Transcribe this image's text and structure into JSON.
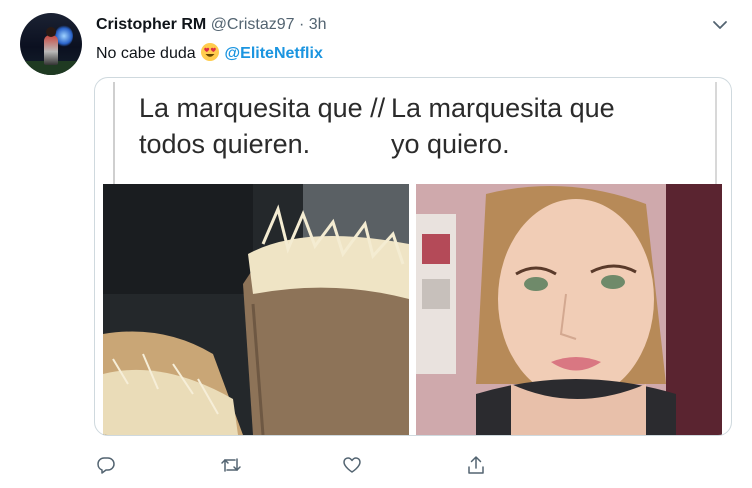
{
  "tweet": {
    "author_name": "Cristopher RM",
    "handle": "@Cristaz97",
    "separator": "·",
    "time": "3h",
    "text_prefix": "No cabe duda",
    "mention": "@EliteNetflix",
    "emoji": "smiling-face-with-heart-eyes"
  },
  "media": {
    "caption_left_line1": "La marquesita que //",
    "caption_left_line2": "todos quieren.",
    "caption_right_line1": "La marquesita que",
    "caption_right_line2": "yo quiero."
  },
  "actions": {
    "reply_icon": "reply-icon",
    "retweet_icon": "retweet-icon",
    "like_icon": "heart-icon",
    "share_icon": "share-icon"
  },
  "colors": {
    "link": "#1b95e0",
    "muted": "#536471",
    "border": "#cfd9de"
  }
}
